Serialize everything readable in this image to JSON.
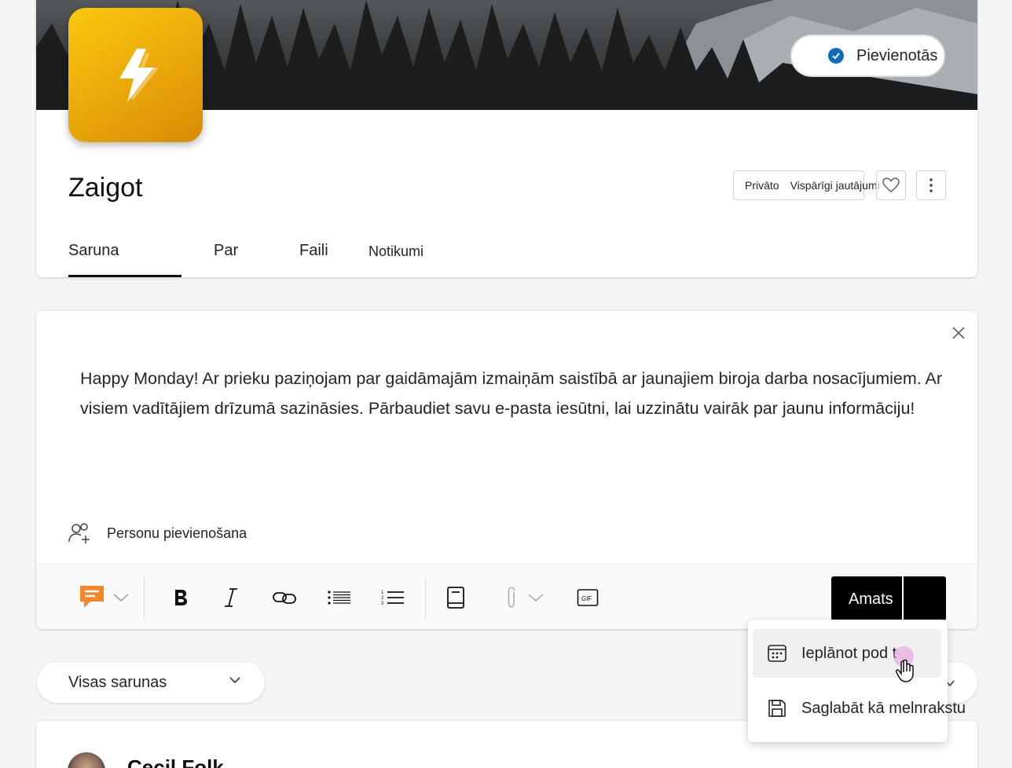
{
  "header": {
    "joined_label": "Pievienotās",
    "group_name": "Zaigot",
    "privacy_label": "Privāto",
    "category_label": "Vispārīgi jautājumi"
  },
  "tabs": [
    {
      "label": "Saruna",
      "active": true
    },
    {
      "label": "Par",
      "active": false
    },
    {
      "label": "Faili",
      "active": false
    },
    {
      "label": "Notikumi",
      "active": false
    }
  ],
  "composer": {
    "message": "Happy Monday! Ar prieku paziņojam par gaidāmajām izmaiņām saistībā ar jaunajiem biroja darba nosacījumiem. Ar visiem vadītājiem drīzumā sazināsies. Pārbaudiet savu e-pasta iesūtni, lai uzzinātu vairāk par jaunu informāciju!",
    "add_people_label": "Personu pievienošana",
    "post_label": "Amats",
    "toolbar_icons": [
      "message-type-icon",
      "bold-icon",
      "italic-icon",
      "link-icon",
      "bulleted-list-icon",
      "numbered-list-icon",
      "book-icon",
      "attach-icon",
      "gif-icon"
    ]
  },
  "post_menu": {
    "items": [
      {
        "label": "Ieplānot pod t",
        "icon": "calendar-icon"
      },
      {
        "label": "Saglabāt kā melnrakstu",
        "icon": "save-icon"
      }
    ]
  },
  "filter": {
    "selected": "Visas sarunas"
  },
  "post": {
    "author": "Cecil Folk"
  },
  "colors": {
    "accent": "#0f6cbd",
    "logo": "#f2b705",
    "post_button": "#000000"
  }
}
